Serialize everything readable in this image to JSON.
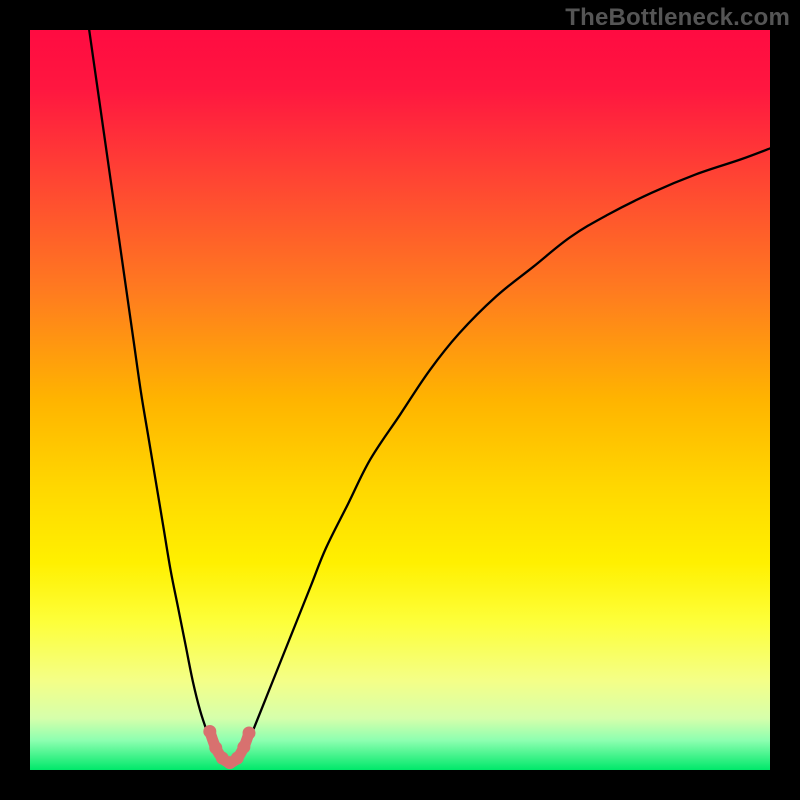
{
  "watermark": "TheBottleneck.com",
  "chart_data": {
    "type": "line",
    "title": "",
    "xlabel": "",
    "ylabel": "",
    "xlim": [
      0,
      100
    ],
    "ylim": [
      0,
      100
    ],
    "gradient_stops": [
      {
        "offset": 0.0,
        "color": "#ff0b41"
      },
      {
        "offset": 0.08,
        "color": "#ff1740"
      },
      {
        "offset": 0.2,
        "color": "#ff4433"
      },
      {
        "offset": 0.35,
        "color": "#ff7a20"
      },
      {
        "offset": 0.5,
        "color": "#ffb400"
      },
      {
        "offset": 0.62,
        "color": "#ffd800"
      },
      {
        "offset": 0.72,
        "color": "#fff000"
      },
      {
        "offset": 0.8,
        "color": "#fdff3a"
      },
      {
        "offset": 0.88,
        "color": "#f4ff88"
      },
      {
        "offset": 0.93,
        "color": "#d6ffab"
      },
      {
        "offset": 0.96,
        "color": "#8dffb0"
      },
      {
        "offset": 1.0,
        "color": "#00e86a"
      }
    ],
    "series": [
      {
        "name": "left-branch",
        "x": [
          8,
          9,
          10,
          11,
          12,
          13,
          14,
          15,
          16,
          17,
          18,
          19,
          20,
          21,
          22,
          23,
          24,
          25,
          26
        ],
        "y": [
          100,
          93,
          86,
          79,
          72,
          65,
          58,
          51,
          45,
          39,
          33,
          27,
          22,
          17,
          12,
          8,
          5,
          2.5,
          1
        ]
      },
      {
        "name": "right-branch",
        "x": [
          28,
          29,
          30,
          32,
          34,
          36,
          38,
          40,
          43,
          46,
          50,
          54,
          58,
          63,
          68,
          73,
          78,
          84,
          90,
          96,
          100
        ],
        "y": [
          1,
          2.5,
          5,
          10,
          15,
          20,
          25,
          30,
          36,
          42,
          48,
          54,
          59,
          64,
          68,
          72,
          75,
          78,
          80.5,
          82.5,
          84
        ]
      }
    ],
    "valley_marker": {
      "name": "valley-marker",
      "color": "#d8716f",
      "points": [
        {
          "x": 24.3,
          "y": 5.2
        },
        {
          "x": 25.1,
          "y": 3.0
        },
        {
          "x": 26.0,
          "y": 1.6
        },
        {
          "x": 27.0,
          "y": 1.0
        },
        {
          "x": 28.0,
          "y": 1.6
        },
        {
          "x": 28.9,
          "y": 3.1
        },
        {
          "x": 29.6,
          "y": 5.0
        }
      ]
    }
  }
}
